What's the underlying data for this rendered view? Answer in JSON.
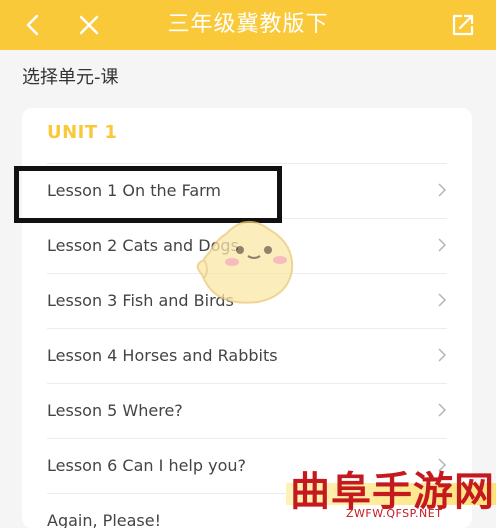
{
  "header": {
    "title": "三年级冀教版下",
    "back_icon": "chevron-left-icon",
    "close_icon": "close-icon",
    "share_icon": "share-icon",
    "background": "#f9c93a"
  },
  "section": {
    "title": "选择单元-课"
  },
  "unit": {
    "label": "UNIT 1",
    "accent": "#f9c93a",
    "lessons": [
      {
        "label": "Lesson 1 On the Farm"
      },
      {
        "label": "Lesson 2 Cats and Dogs"
      },
      {
        "label": "Lesson 3 Fish and Birds"
      },
      {
        "label": "Lesson 4 Horses and Rabbits"
      },
      {
        "label": "Lesson 5 Where?"
      },
      {
        "label": "Lesson 6 Can I help you?"
      },
      {
        "label": "Again, Please!"
      }
    ]
  },
  "watermark": {
    "text": "曲阜手游网",
    "url": "ZWFW.QFSP.NET",
    "color": "#c4191f"
  }
}
